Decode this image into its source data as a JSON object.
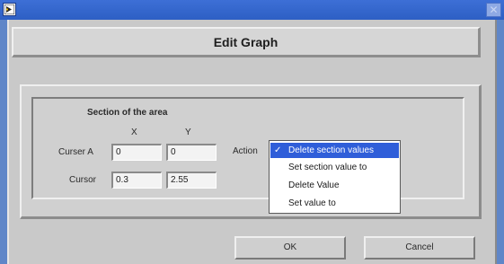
{
  "window": {
    "title": ""
  },
  "header": {
    "title": "Edit Graph"
  },
  "section": {
    "title": "Section of the area",
    "col_x": "X",
    "col_y": "Y",
    "rows": [
      {
        "label": "Curser A",
        "x": "0",
        "y": "0"
      },
      {
        "label": "Cursor",
        "x": "0.3",
        "y": "2.55"
      }
    ]
  },
  "action": {
    "label": "Action",
    "options": [
      {
        "label": "Delete section values",
        "selected": true
      },
      {
        "label": "Set section value to",
        "selected": false
      },
      {
        "label": "Delete Value",
        "selected": false
      },
      {
        "label": "Set value to",
        "selected": false
      }
    ],
    "check_mark": "✓"
  },
  "buttons": {
    "ok": "OK",
    "cancel": "Cancel"
  },
  "colors": {
    "titlebar": "#2d5fc4",
    "selection": "#2f5ed9",
    "dialog": "#c9c9c9"
  },
  "icons": {
    "app": "labview-app-icon",
    "close": "close-icon"
  }
}
